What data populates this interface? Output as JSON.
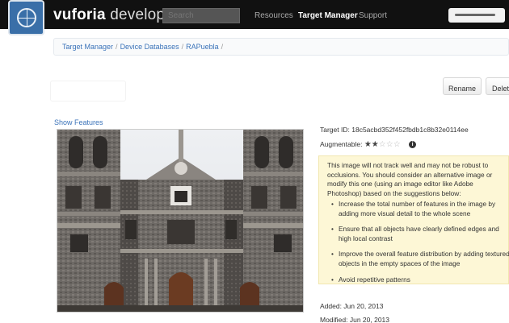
{
  "header": {
    "brand_bold": "vuforia",
    "brand_light": "developer",
    "search_placeholder": "Search",
    "nav": [
      {
        "label": "Resources",
        "active": false
      },
      {
        "label": "Target Manager",
        "active": true
      },
      {
        "label": "Support",
        "active": false
      }
    ]
  },
  "breadcrumb": {
    "items": [
      "Target Manager",
      "Device Databases",
      "RAPuebla"
    ],
    "separator": "/"
  },
  "actions": {
    "rename_label": "Rename",
    "delete_label": "Delete"
  },
  "show_features_label": "Show Features",
  "details": {
    "target_id_label": "Target ID:",
    "target_id": "18c5acbd352f452fbdb1c8b32e0114ee",
    "augmentable_label": "Augmentable:",
    "rating": 2,
    "rating_max": 5,
    "added": "Added: Jun 20, 2013",
    "modified": "Modified: Jun 20, 2013"
  },
  "warning": {
    "intro": "This image will not track well and may not be robust to occlusions. You should consider an alternative image or modify this one (using an image editor like Adobe Photoshop) based on the suggestions below:",
    "suggestions": [
      "Increase the total number of features in the image by adding more visual detail to the whole scene",
      "Ensure that all objects have clearly defined edges and high local contrast",
      "Improve the overall feature distribution by adding textured objects in the empty spaces of the image",
      "Avoid repetitive patterns"
    ]
  },
  "colors": {
    "topbar": "#111111",
    "link": "#3b73b9",
    "warning_bg": "#fdf7d6",
    "logo": "#3a6fa8"
  }
}
